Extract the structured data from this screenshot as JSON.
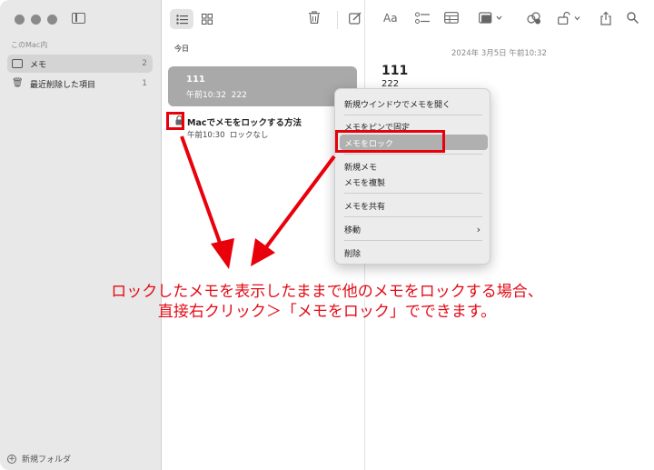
{
  "sidebar": {
    "section_label": "このMac内",
    "items": [
      {
        "label": "メモ",
        "count": "2",
        "icon": "folder-icon"
      },
      {
        "label": "最近削除した項目",
        "count": "1",
        "icon": "trash-icon"
      }
    ],
    "new_folder_label": "新規フォルダ"
  },
  "list": {
    "date_header": "今日",
    "notes": [
      {
        "title": "111",
        "time": "午前10:32",
        "preview": "222"
      },
      {
        "title": "Macでメモをロックする方法",
        "time": "午前10:30",
        "preview": "ロックなし"
      }
    ]
  },
  "note": {
    "date": "2024年 3月5日 午前10:32",
    "title": "111",
    "body": "222"
  },
  "context_menu": {
    "items": [
      "新規ウインドウでメモを開く",
      "メモをピンで固定",
      "メモをロック",
      "新規メモ",
      "メモを複製",
      "メモを共有",
      "移動",
      "削除"
    ],
    "highlighted_index": 2
  },
  "annotation": {
    "line1": "ロックしたメモを表示したままで他のメモをロックする場合、",
    "line2": "直接右クリック＞「メモをロック」でできます。"
  },
  "colors": {
    "annotation_red": "#e30b16",
    "highlight_gray": "#b0b0b0",
    "selected_note": "#a9a9a9"
  }
}
